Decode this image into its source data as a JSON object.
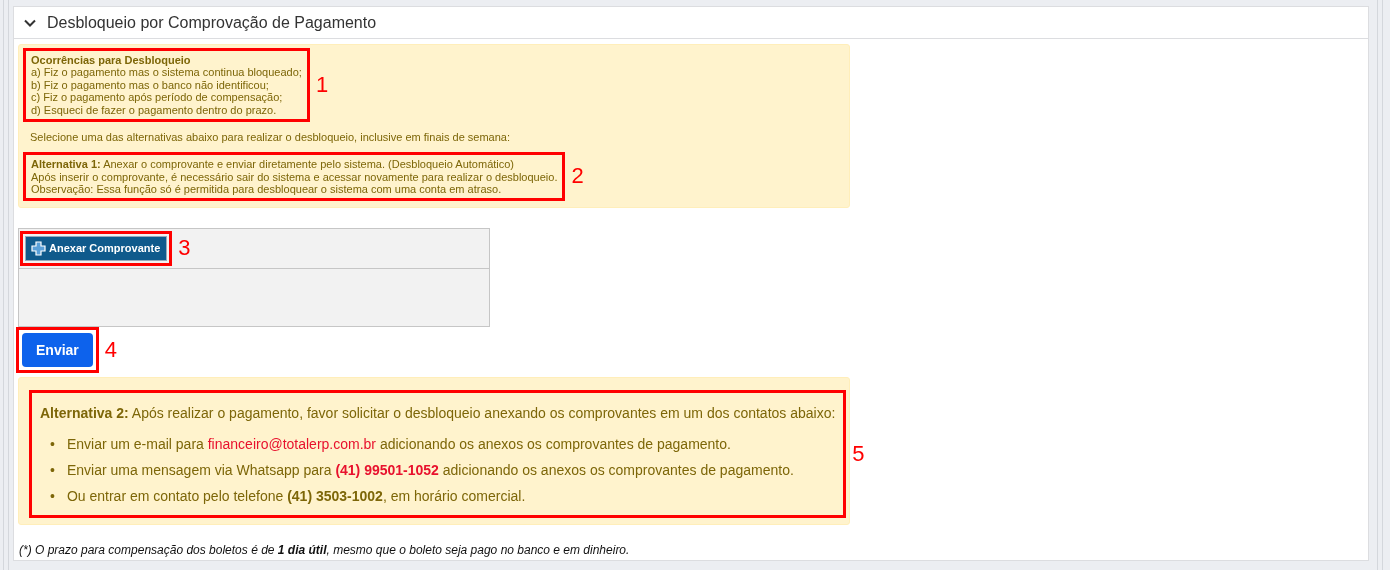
{
  "panel": {
    "title": "Desbloqueio por Comprovação de Pagamento",
    "expanded": true
  },
  "notice": {
    "heading": "Ocorrências para Desbloqueio",
    "items": [
      "a) Fiz o pagamento mas o sistema continua bloqueado;",
      "b) Fiz o pagamento mas o banco não identificou;",
      "c) Fiz o pagamento após período de compensação;",
      "d) Esqueci de fazer o pagamento dentro do prazo."
    ],
    "prompt": "Selecione uma das alternativas abaixo para realizar o desbloqueio, inclusive em finais de semana:",
    "alternative_1": [
      "**Alternativa 1:** Anexar o comprovante e enviar diretamente pelo sistema. (Desbloqueio Automático)",
      "Após inserir o comprovante, é necessário sair do sistema e acessar novamente para realizar o desbloqueio.",
      "Observação: Essa função só é permitida para desbloquear o sistema com uma conta em atraso."
    ]
  },
  "upload": {
    "button": "Anexar Comprovante"
  },
  "submit_button": "Enviar",
  "alternative_2": {
    "intro": "**Alternativa 2:** Após realizar o pagamento, favor solicitar o desbloqueio anexando os comprovantes em um dos contatos abaixo:",
    "items": [
      {
        "bullet": "•",
        "parts": [
          {
            "kind": "plain",
            "text": "Enviar um e-mail para "
          },
          {
            "kind": "highlight",
            "text": "financeiro@totalerp.com.br"
          },
          {
            "kind": "plain",
            "text": " adicionando os anexos os comprovantes de pagamento."
          }
        ]
      },
      {
        "bullet": "•",
        "parts": [
          {
            "kind": "plain",
            "text": "Enviar uma mensagem via Whatsapp para "
          },
          {
            "kind": "highlight",
            "text": "(41) 99501-1052"
          },
          {
            "kind": "plain",
            "text": " adicionando os anexos os comprovantes de pagamento."
          }
        ]
      },
      {
        "bullet": "•",
        "parts": [
          {
            "kind": "plain",
            "text": "Ou entrar em contato pelo telefone "
          },
          {
            "kind": "strong",
            "text": "(41) 3503-1002"
          },
          {
            "kind": "plain",
            "text": ", em horário comercial."
          }
        ]
      }
    ]
  },
  "footnote": "(*) O prazo para compensação dos boletos é de **1 dia útil**, mesmo que o boleto seja pago no banco e em dinheiro.",
  "annotations": [
    "1",
    "2",
    "3",
    "4",
    "5"
  ]
}
